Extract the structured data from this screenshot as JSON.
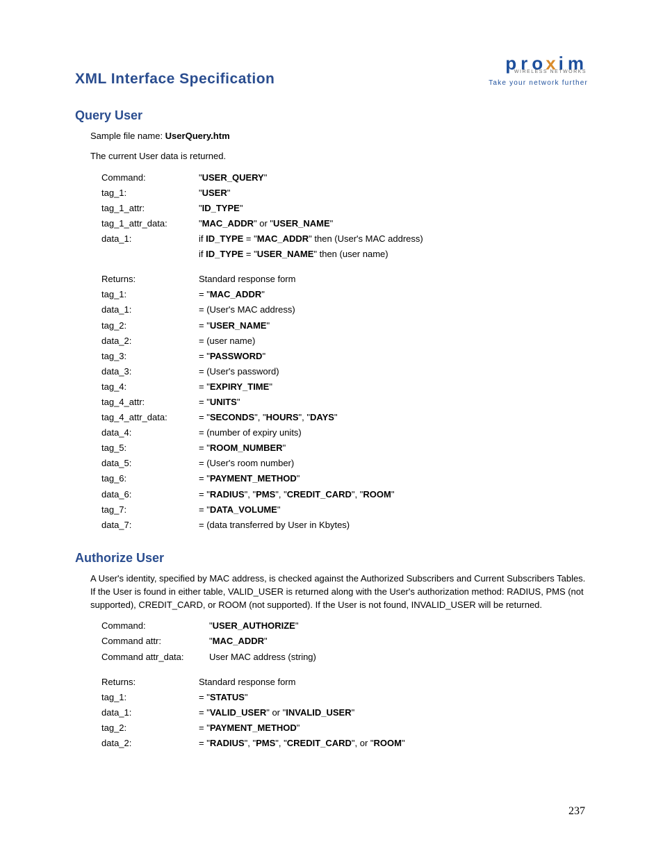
{
  "header": {
    "title": "XML Interface Specification",
    "logo_brand_pro": "pro",
    "logo_brand_x": "x",
    "logo_brand_im": "im",
    "logo_sub": "WIRELESS NETWORKS",
    "logo_tag": "Take your network further"
  },
  "query_user": {
    "title": "Query User",
    "sample_label": "Sample file name: ",
    "sample_file": "UserQuery.htm",
    "desc": "The current User data is returned.",
    "rows1": [
      {
        "label": "Command:",
        "value": "\"<b>USER_QUERY</b>\""
      },
      {
        "label": "tag_1:",
        "value": "\"<b>USER</b>\""
      },
      {
        "label": "tag_1_attr:",
        "value": "\"<b>ID_TYPE</b>\""
      },
      {
        "label": "tag_1_attr_data:",
        "value": "\"<b>MAC_ADDR</b>\" or \"<b>USER_NAME</b>\""
      },
      {
        "label": "data_1:",
        "value": "if <b>ID_TYPE</b> = \"<b>MAC_ADDR</b>\" then (User's MAC address)"
      },
      {
        "label": "",
        "value": "if <b>ID_TYPE</b> = \"<b>USER_NAME</b>\" then (user name)"
      }
    ],
    "rows2": [
      {
        "label": "Returns:",
        "value": "Standard response form"
      },
      {
        "label": "tag_1:",
        "value": "= \"<b>MAC_ADDR</b>\""
      },
      {
        "label": "data_1:",
        "value": "= (User's MAC address)"
      },
      {
        "label": "tag_2:",
        "value": "= \"<b>USER_NAME</b>\""
      },
      {
        "label": "data_2:",
        "value": "= (user name)"
      },
      {
        "label": "tag_3:",
        "value": "= \"<b>PASSWORD</b>\""
      },
      {
        "label": "data_3:",
        "value": "= (User's password)"
      },
      {
        "label": "tag_4:",
        "value": "= \"<b>EXPIRY_TIME</b>\""
      },
      {
        "label": "tag_4_attr:",
        "value": "= \"<b>UNITS</b>\""
      },
      {
        "label": "tag_4_attr_data:",
        "value": "= \"<b>SECONDS</b>\", \"<b>HOURS</b>\", \"<b>DAYS</b>\""
      },
      {
        "label": "data_4:",
        "value": "= (number of expiry units)"
      },
      {
        "label": "tag_5:",
        "value": "= \"<b>ROOM_NUMBER</b>\""
      },
      {
        "label": "data_5:",
        "value": "= (User's room number)"
      },
      {
        "label": "tag_6:",
        "value": "= \"<b>PAYMENT_METHOD</b>\""
      },
      {
        "label": "data_6:",
        "value": "= \"<b>RADIUS</b>\", \"<b>PMS</b>\", \"<b>CREDIT_CARD</b>\", \"<b>ROOM</b>\""
      },
      {
        "label": "tag_7:",
        "value": "= \"<b>DATA_VOLUME</b>\""
      },
      {
        "label": "data_7:",
        "value": "= (data transferred by User in Kbytes)"
      }
    ]
  },
  "authorize_user": {
    "title": "Authorize User",
    "desc": "A User's identity, specified by MAC address, is checked against the Authorized Subscribers and Current Subscribers Tables. If the User is found in either table, VALID_USER is returned along with the User's authorization method: RADIUS, PMS (not supported), CREDIT_CARD, or ROOM (not supported). If the User is not found, INVALID_USER will be returned.",
    "rows1": [
      {
        "label": "Command:",
        "value": "\"<b>USER_AUTHORIZE</b>\""
      },
      {
        "label": "Command attr:",
        "value": "\"<b>MAC_ADDR</b>\""
      },
      {
        "label": "Command attr_data:",
        "value": "User MAC address (string)"
      }
    ],
    "rows2": [
      {
        "label": "Returns:",
        "value": "Standard response form"
      },
      {
        "label": "tag_1:",
        "value": "= \"<b>STATUS</b>\""
      },
      {
        "label": "data_1:",
        "value": "= \"<b>VALID_USER</b>\" or \"<b>INVALID_USER</b>\""
      },
      {
        "label": "tag_2:",
        "value": "= \"<b>PAYMENT_METHOD</b>\""
      },
      {
        "label": "data_2:",
        "value": "= \"<b>RADIUS</b>\", \"<b>PMS</b>\", \"<b>CREDIT_CARD</b>\", or \"<b>ROOM</b>\""
      }
    ]
  },
  "page_number": "237"
}
